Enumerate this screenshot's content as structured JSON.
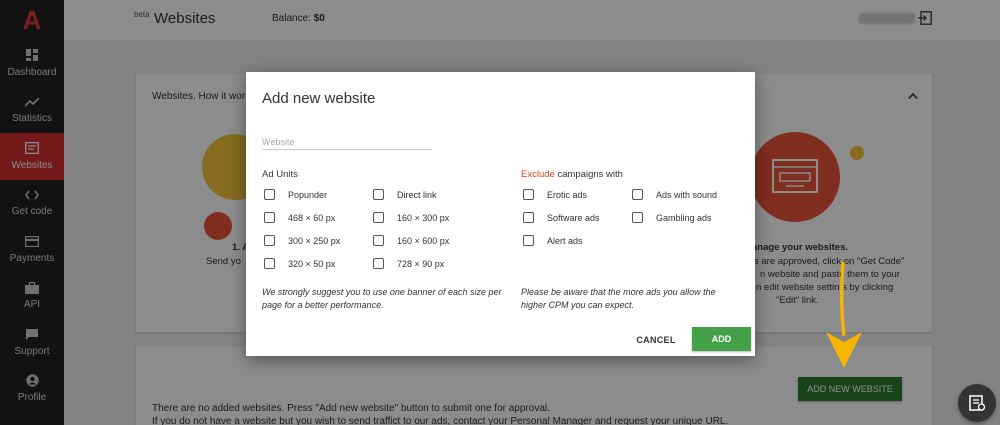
{
  "sidebar": {
    "logo": "A",
    "items": [
      {
        "label": "Dashboard",
        "icon": "dashboard-icon"
      },
      {
        "label": "Statistics",
        "icon": "trending-icon"
      },
      {
        "label": "Websites",
        "icon": "websites-icon",
        "active": true
      },
      {
        "label": "Get code",
        "icon": "code-icon"
      },
      {
        "label": "Payments",
        "icon": "credit-card-icon"
      },
      {
        "label": "API",
        "icon": "briefcase-icon"
      },
      {
        "label": "Support",
        "icon": "chat-icon"
      },
      {
        "label": "Profile",
        "icon": "user-icon"
      }
    ]
  },
  "header": {
    "beta": "beta",
    "title": "Websites",
    "balance_label": "Balance:",
    "balance_value": "$0"
  },
  "background": {
    "card_title": "Websites. How it wor",
    "step1_title": "1. A",
    "step1_line": "Send yo",
    "step3_title": "Manage your websites.",
    "step3_lines": [
      "s are approved, click on \"Get Code\"",
      "n website and paste them to your",
      "n edit website settin s by clicking",
      "\"Edit\" link."
    ],
    "add_new_button": "ADD NEW WEBSITE",
    "info_line1": "There are no added websites. Press \"Add new website\" button to submit one for approval.",
    "info_line2": "If you do not have a website but you wish to send traffict to our ads, contact your Personal Manager and request your unique URL."
  },
  "modal": {
    "title": "Add new website",
    "website_placeholder": "Website",
    "website_value": "",
    "ad_units_label": "Ad Units",
    "ad_units_col1": [
      "Popunder",
      "468 × 60 px",
      "300 × 250 px",
      "320 × 50 px"
    ],
    "ad_units_col2": [
      "Direct link",
      "160 × 300 px",
      "160 × 600 px",
      "728 × 90 px"
    ],
    "exclude_word": "Exclude",
    "exclude_rest": " campaigns with",
    "exclude_col1": [
      "Erotic ads",
      "Software ads",
      "Alert ads"
    ],
    "exclude_col2": [
      "Ads with sound",
      "Gambling ads"
    ],
    "note_left": "We strongly suggest you to use one banner of each size per page for a better performance.",
    "note_right": "Please be aware that the more ads you allow the higher CPM you can expect.",
    "cancel_label": "CANCEL",
    "add_label": "ADD"
  },
  "colors": {
    "accent_red": "#d32f2f",
    "add_green": "#43a047",
    "arrow_yellow": "#f4b400",
    "sidebar_bg": "#222222"
  }
}
